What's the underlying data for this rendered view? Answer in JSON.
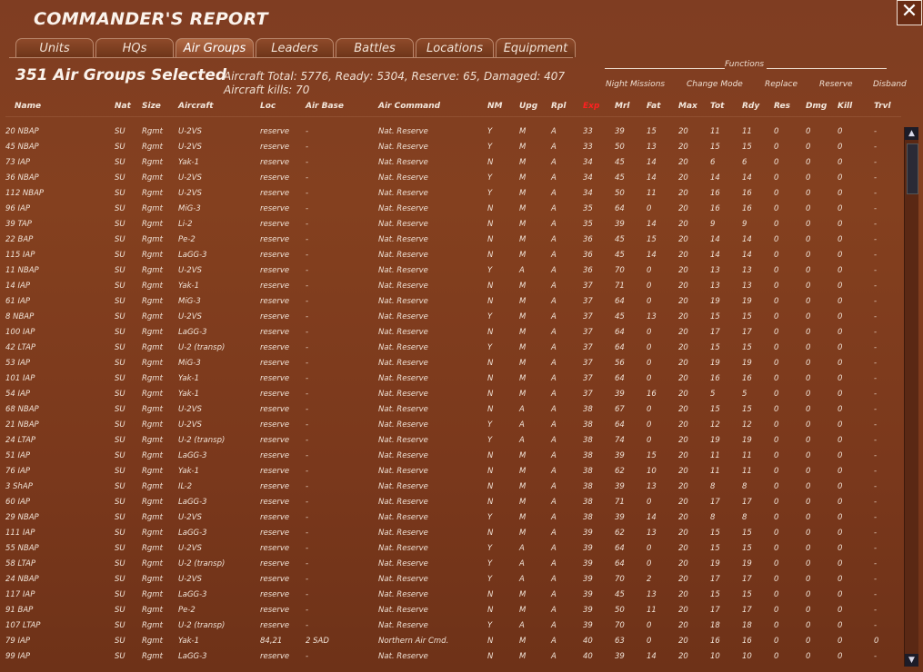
{
  "window": {
    "title": "COMMANDER'S REPORT",
    "close_glyph": "✕"
  },
  "tabs": [
    "Units",
    "HQs",
    "Air Groups",
    "Leaders",
    "Battles",
    "Locations",
    "Equipment"
  ],
  "active_tab": "Air Groups",
  "header": {
    "selected": "351 Air Groups Selected",
    "summary_line1": "Aircraft Total: 5776, Ready: 5304, Reserve: 65, Damaged: 407",
    "summary_line2": "Aircraft kills: 70"
  },
  "functions": {
    "title": "Functions",
    "items": [
      "Night Missions",
      "Change Mode",
      "Replace",
      "Reserve",
      "Disband"
    ]
  },
  "columns": [
    "Name",
    "Nat",
    "Size",
    "Aircraft",
    "Loc",
    "Air Base",
    "Air Command",
    "NM",
    "Upg",
    "Rpl",
    "Exp",
    "Mrl",
    "Fat",
    "Max",
    "Tot",
    "Rdy",
    "Res",
    "Dmg",
    "Kill",
    "Trvl"
  ],
  "sorted_column": "Exp",
  "colors": {
    "sorted_header": "#ff2020",
    "background": "#7a3a20"
  },
  "rows": [
    [
      "20 NBAP",
      "SU",
      "Rgmt",
      "U-2VS",
      "reserve",
      "-",
      "Nat. Reserve",
      "Y",
      "M",
      "A",
      "33",
      "39",
      "15",
      "20",
      "11",
      "11",
      "0",
      "0",
      "0",
      "-"
    ],
    [
      "45 NBAP",
      "SU",
      "Rgmt",
      "U-2VS",
      "reserve",
      "-",
      "Nat. Reserve",
      "Y",
      "M",
      "A",
      "33",
      "50",
      "13",
      "20",
      "15",
      "15",
      "0",
      "0",
      "0",
      "-"
    ],
    [
      "73 IAP",
      "SU",
      "Rgmt",
      "Yak-1",
      "reserve",
      "-",
      "Nat. Reserve",
      "N",
      "M",
      "A",
      "34",
      "45",
      "14",
      "20",
      "6",
      "6",
      "0",
      "0",
      "0",
      "-"
    ],
    [
      "36 NBAP",
      "SU",
      "Rgmt",
      "U-2VS",
      "reserve",
      "-",
      "Nat. Reserve",
      "Y",
      "M",
      "A",
      "34",
      "45",
      "14",
      "20",
      "14",
      "14",
      "0",
      "0",
      "0",
      "-"
    ],
    [
      "112 NBAP",
      "SU",
      "Rgmt",
      "U-2VS",
      "reserve",
      "-",
      "Nat. Reserve",
      "Y",
      "M",
      "A",
      "34",
      "50",
      "11",
      "20",
      "16",
      "16",
      "0",
      "0",
      "0",
      "-"
    ],
    [
      "96 IAP",
      "SU",
      "Rgmt",
      "MiG-3",
      "reserve",
      "-",
      "Nat. Reserve",
      "N",
      "M",
      "A",
      "35",
      "64",
      "0",
      "20",
      "16",
      "16",
      "0",
      "0",
      "0",
      "-"
    ],
    [
      "39 TAP",
      "SU",
      "Rgmt",
      "Li-2",
      "reserve",
      "-",
      "Nat. Reserve",
      "N",
      "M",
      "A",
      "35",
      "39",
      "14",
      "20",
      "9",
      "9",
      "0",
      "0",
      "0",
      "-"
    ],
    [
      "22 BAP",
      "SU",
      "Rgmt",
      "Pe-2",
      "reserve",
      "-",
      "Nat. Reserve",
      "N",
      "M",
      "A",
      "36",
      "45",
      "15",
      "20",
      "14",
      "14",
      "0",
      "0",
      "0",
      "-"
    ],
    [
      "115 IAP",
      "SU",
      "Rgmt",
      "LaGG-3",
      "reserve",
      "-",
      "Nat. Reserve",
      "N",
      "M",
      "A",
      "36",
      "45",
      "14",
      "20",
      "14",
      "14",
      "0",
      "0",
      "0",
      "-"
    ],
    [
      "11 NBAP",
      "SU",
      "Rgmt",
      "U-2VS",
      "reserve",
      "-",
      "Nat. Reserve",
      "Y",
      "A",
      "A",
      "36",
      "70",
      "0",
      "20",
      "13",
      "13",
      "0",
      "0",
      "0",
      "-"
    ],
    [
      "14 IAP",
      "SU",
      "Rgmt",
      "Yak-1",
      "reserve",
      "-",
      "Nat. Reserve",
      "N",
      "M",
      "A",
      "37",
      "71",
      "0",
      "20",
      "13",
      "13",
      "0",
      "0",
      "0",
      "-"
    ],
    [
      "61 IAP",
      "SU",
      "Rgmt",
      "MiG-3",
      "reserve",
      "-",
      "Nat. Reserve",
      "N",
      "M",
      "A",
      "37",
      "64",
      "0",
      "20",
      "19",
      "19",
      "0",
      "0",
      "0",
      "-"
    ],
    [
      "8 NBAP",
      "SU",
      "Rgmt",
      "U-2VS",
      "reserve",
      "-",
      "Nat. Reserve",
      "Y",
      "M",
      "A",
      "37",
      "45",
      "13",
      "20",
      "15",
      "15",
      "0",
      "0",
      "0",
      "-"
    ],
    [
      "100 IAP",
      "SU",
      "Rgmt",
      "LaGG-3",
      "reserve",
      "-",
      "Nat. Reserve",
      "N",
      "M",
      "A",
      "37",
      "64",
      "0",
      "20",
      "17",
      "17",
      "0",
      "0",
      "0",
      "-"
    ],
    [
      "42 LTAP",
      "SU",
      "Rgmt",
      "U-2 (transp)",
      "reserve",
      "-",
      "Nat. Reserve",
      "Y",
      "M",
      "A",
      "37",
      "64",
      "0",
      "20",
      "15",
      "15",
      "0",
      "0",
      "0",
      "-"
    ],
    [
      "53 IAP",
      "SU",
      "Rgmt",
      "MiG-3",
      "reserve",
      "-",
      "Nat. Reserve",
      "N",
      "M",
      "A",
      "37",
      "56",
      "0",
      "20",
      "19",
      "19",
      "0",
      "0",
      "0",
      "-"
    ],
    [
      "101 IAP",
      "SU",
      "Rgmt",
      "Yak-1",
      "reserve",
      "-",
      "Nat. Reserve",
      "N",
      "M",
      "A",
      "37",
      "64",
      "0",
      "20",
      "16",
      "16",
      "0",
      "0",
      "0",
      "-"
    ],
    [
      "54 IAP",
      "SU",
      "Rgmt",
      "Yak-1",
      "reserve",
      "-",
      "Nat. Reserve",
      "N",
      "M",
      "A",
      "37",
      "39",
      "16",
      "20",
      "5",
      "5",
      "0",
      "0",
      "0",
      "-"
    ],
    [
      "68 NBAP",
      "SU",
      "Rgmt",
      "U-2VS",
      "reserve",
      "-",
      "Nat. Reserve",
      "N",
      "A",
      "A",
      "38",
      "67",
      "0",
      "20",
      "15",
      "15",
      "0",
      "0",
      "0",
      "-"
    ],
    [
      "21 NBAP",
      "SU",
      "Rgmt",
      "U-2VS",
      "reserve",
      "-",
      "Nat. Reserve",
      "Y",
      "A",
      "A",
      "38",
      "64",
      "0",
      "20",
      "12",
      "12",
      "0",
      "0",
      "0",
      "-"
    ],
    [
      "24 LTAP",
      "SU",
      "Rgmt",
      "U-2 (transp)",
      "reserve",
      "-",
      "Nat. Reserve",
      "Y",
      "A",
      "A",
      "38",
      "74",
      "0",
      "20",
      "19",
      "19",
      "0",
      "0",
      "0",
      "-"
    ],
    [
      "51 IAP",
      "SU",
      "Rgmt",
      "LaGG-3",
      "reserve",
      "-",
      "Nat. Reserve",
      "N",
      "M",
      "A",
      "38",
      "39",
      "15",
      "20",
      "11",
      "11",
      "0",
      "0",
      "0",
      "-"
    ],
    [
      "76 IAP",
      "SU",
      "Rgmt",
      "Yak-1",
      "reserve",
      "-",
      "Nat. Reserve",
      "N",
      "M",
      "A",
      "38",
      "62",
      "10",
      "20",
      "11",
      "11",
      "0",
      "0",
      "0",
      "-"
    ],
    [
      "3 ShAP",
      "SU",
      "Rgmt",
      "IL-2",
      "reserve",
      "-",
      "Nat. Reserve",
      "N",
      "M",
      "A",
      "38",
      "39",
      "13",
      "20",
      "8",
      "8",
      "0",
      "0",
      "0",
      "-"
    ],
    [
      "60 IAP",
      "SU",
      "Rgmt",
      "LaGG-3",
      "reserve",
      "-",
      "Nat. Reserve",
      "N",
      "M",
      "A",
      "38",
      "71",
      "0",
      "20",
      "17",
      "17",
      "0",
      "0",
      "0",
      "-"
    ],
    [
      "29 NBAP",
      "SU",
      "Rgmt",
      "U-2VS",
      "reserve",
      "-",
      "Nat. Reserve",
      "Y",
      "M",
      "A",
      "38",
      "39",
      "14",
      "20",
      "8",
      "8",
      "0",
      "0",
      "0",
      "-"
    ],
    [
      "111 IAP",
      "SU",
      "Rgmt",
      "LaGG-3",
      "reserve",
      "-",
      "Nat. Reserve",
      "N",
      "M",
      "A",
      "39",
      "62",
      "13",
      "20",
      "15",
      "15",
      "0",
      "0",
      "0",
      "-"
    ],
    [
      "55 NBAP",
      "SU",
      "Rgmt",
      "U-2VS",
      "reserve",
      "-",
      "Nat. Reserve",
      "Y",
      "A",
      "A",
      "39",
      "64",
      "0",
      "20",
      "15",
      "15",
      "0",
      "0",
      "0",
      "-"
    ],
    [
      "58 LTAP",
      "SU",
      "Rgmt",
      "U-2 (transp)",
      "reserve",
      "-",
      "Nat. Reserve",
      "Y",
      "A",
      "A",
      "39",
      "64",
      "0",
      "20",
      "19",
      "19",
      "0",
      "0",
      "0",
      "-"
    ],
    [
      "24 NBAP",
      "SU",
      "Rgmt",
      "U-2VS",
      "reserve",
      "-",
      "Nat. Reserve",
      "Y",
      "A",
      "A",
      "39",
      "70",
      "2",
      "20",
      "17",
      "17",
      "0",
      "0",
      "0",
      "-"
    ],
    [
      "117 IAP",
      "SU",
      "Rgmt",
      "LaGG-3",
      "reserve",
      "-",
      "Nat. Reserve",
      "N",
      "M",
      "A",
      "39",
      "45",
      "13",
      "20",
      "15",
      "15",
      "0",
      "0",
      "0",
      "-"
    ],
    [
      "91 BAP",
      "SU",
      "Rgmt",
      "Pe-2",
      "reserve",
      "-",
      "Nat. Reserve",
      "N",
      "M",
      "A",
      "39",
      "50",
      "11",
      "20",
      "17",
      "17",
      "0",
      "0",
      "0",
      "-"
    ],
    [
      "107 LTAP",
      "SU",
      "Rgmt",
      "U-2 (transp)",
      "reserve",
      "-",
      "Nat. Reserve",
      "Y",
      "A",
      "A",
      "39",
      "70",
      "0",
      "20",
      "18",
      "18",
      "0",
      "0",
      "0",
      "-"
    ],
    [
      "79 IAP",
      "SU",
      "Rgmt",
      "Yak-1",
      "84,21",
      "2 SAD",
      "Northern Air Cmd.",
      "N",
      "M",
      "A",
      "40",
      "63",
      "0",
      "20",
      "16",
      "16",
      "0",
      "0",
      "0",
      "0"
    ],
    [
      "99 IAP",
      "SU",
      "Rgmt",
      "LaGG-3",
      "reserve",
      "-",
      "Nat. Reserve",
      "N",
      "M",
      "A",
      "40",
      "39",
      "14",
      "20",
      "10",
      "10",
      "0",
      "0",
      "0",
      "-"
    ]
  ],
  "scrollbar": {
    "up_icon": "▲",
    "down_icon": "▼"
  }
}
